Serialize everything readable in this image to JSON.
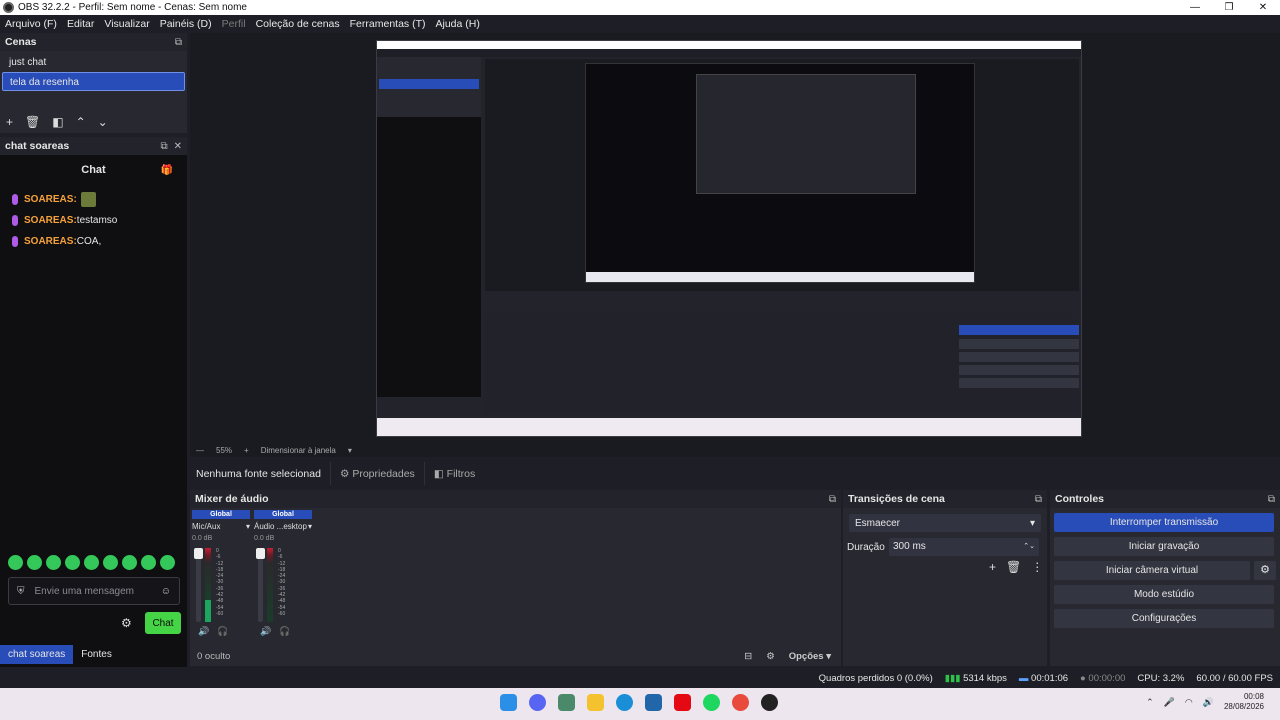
{
  "window": {
    "title": "OBS 32.2.2 - Perfil: Sem nome - Cenas: Sem nome",
    "min": "—",
    "max": "❐",
    "close": "✕"
  },
  "menu": [
    "Arquivo (F)",
    "Editar",
    "Visualizar",
    "Painéis (D)",
    "Perfil",
    "Coleção de cenas",
    "Ferramentas (T)",
    "Ajuda (H)"
  ],
  "scenes": {
    "title": "Cenas",
    "items": [
      "just chat",
      "tela da resenha"
    ],
    "selected": 1
  },
  "chat_dock": {
    "title": "chat soareas",
    "header": "Chat",
    "messages": [
      {
        "user": "SOAREAS:",
        "text": ""
      },
      {
        "user": "SOAREAS:",
        "text": " testamso"
      },
      {
        "user": "SOAREAS:",
        "text": " COA,"
      }
    ],
    "input_placeholder": "Envie uma mensagem",
    "send_label": "Chat"
  },
  "bottom_tabs": [
    "chat soareas",
    "Fontes"
  ],
  "preview_controls": {
    "minus": "—",
    "zoom": "55%",
    "plus": "+",
    "fit": "Dimensionar à janela"
  },
  "source_bar": {
    "no_source": "Nenhuma fonte selecionad",
    "properties": "Propriedades",
    "filters": "Filtros"
  },
  "mixer": {
    "title": "Mixer de áudio",
    "tracks": [
      {
        "global": "Global",
        "name": "Mic/Aux",
        "db": "0.0 dB",
        "level": 0.3
      },
      {
        "global": "Global",
        "name": "Áudio ...esktop",
        "db": "0.0 dB",
        "level": 0.0
      }
    ],
    "scale": [
      "0",
      "-6",
      "-12",
      "-18",
      "-24",
      "-30",
      "-36",
      "-42",
      "-48",
      "-54",
      "-60"
    ],
    "hidden": "0 oculto",
    "options": "Opções"
  },
  "transitions": {
    "title": "Transições de cena",
    "type": "Esmaecer",
    "duration_label": "Duração",
    "duration_value": "300 ms"
  },
  "controls": {
    "title": "Controles",
    "stop_stream": "Interromper transmissão",
    "start_recording": "Iniciar gravação",
    "virtual_cam": "Iniciar câmera virtual",
    "studio_mode": "Modo estúdio",
    "settings": "Configurações"
  },
  "status": {
    "dropped": "Quadros perdidos 0 (0.0%)",
    "bitrate": "5314 kbps",
    "live_time": "00:01:06",
    "rec_time": "00:00:00",
    "cpu": "CPU: 3.2%",
    "fps": "60.00 / 60.00 FPS"
  },
  "clock": {
    "time": "00:08",
    "date": "28/08/2026"
  },
  "colors": {
    "accent": "#284cb8",
    "chat_user": "#f6a13b",
    "send_green": "#45d445"
  }
}
